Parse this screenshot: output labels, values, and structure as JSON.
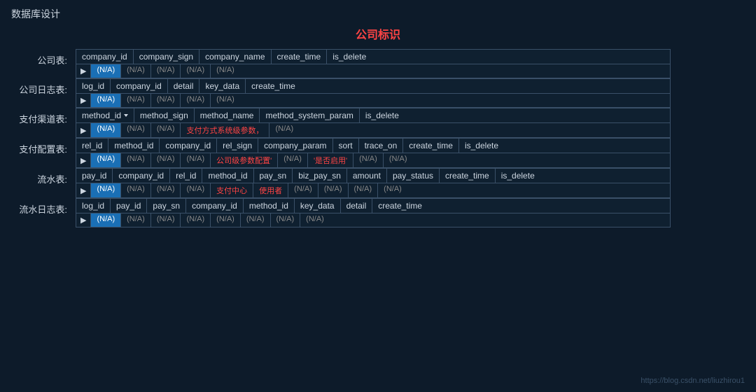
{
  "page": {
    "title": "数据库设计",
    "watermark": "https://blog.csdn.net/liuzhirou1",
    "center_label": "公司标识"
  },
  "tables": [
    {
      "label": "公司表:",
      "columns": [
        "company_id",
        "company_sign",
        "company_name",
        "create_time",
        "is_delete"
      ],
      "cells": [
        "(N/A)",
        "(N/A)",
        "(N/A)",
        "(N/A)",
        "(N/A)"
      ],
      "highlighted_col": 0,
      "special_cells": []
    },
    {
      "label": "公司日志表:",
      "columns": [
        "log_id",
        "company_id",
        "detail",
        "key_data",
        "create_time"
      ],
      "cells": [
        "(N/A)",
        "(N/A)",
        "(N/A)",
        "(N/A)",
        "(N/A)"
      ],
      "highlighted_col": 0,
      "special_cells": []
    },
    {
      "label": "支付渠道表:",
      "columns": [
        "method_id",
        "method_sign",
        "method_name",
        "method_system_param",
        "is_delete"
      ],
      "has_sort_on": 0,
      "cells": [
        "(N/A)",
        "(N/A)",
        "(N/A)",
        "支付方式系统级参数，",
        "(N/A)"
      ],
      "highlighted_col": 0,
      "special_cells": [
        3
      ]
    },
    {
      "label": "支付配置表:",
      "columns": [
        "rel_id",
        "method_id",
        "company_id",
        "rel_sign",
        "company_param",
        "sort",
        "trace_on",
        "create_time",
        "is_delete"
      ],
      "cells": [
        "(N/A)",
        "(N/A)",
        "(N/A)",
        "(N/A)",
        "公司级参数配置'",
        "(N/A)",
        "'是否启用'",
        "(N/A)",
        "(N/A)"
      ],
      "highlighted_col": 0,
      "special_cells": [
        4,
        6
      ]
    },
    {
      "label": "流水表:",
      "columns": [
        "pay_id",
        "company_id",
        "rel_id",
        "method_id",
        "pay_sn",
        "biz_pay_sn",
        "amount",
        "pay_status",
        "create_time",
        "is_delete"
      ],
      "cells": [
        "(N/A)",
        "(N/A)",
        "(N/A)",
        "(N/A)",
        "支付中心",
        "使用者",
        "(N/A)",
        "(N/A)",
        "(N/A)",
        "(N/A)"
      ],
      "highlighted_col": 0,
      "special_cells": [
        4,
        5
      ],
      "center_texts": [
        4,
        5
      ]
    },
    {
      "label": "流水日志表:",
      "columns": [
        "log_id",
        "pay_id",
        "pay_sn",
        "company_id",
        "method_id",
        "key_data",
        "detail",
        "create_time"
      ],
      "cells": [
        "(N/A)",
        "(N/A)",
        "(N/A)",
        "(N/A)",
        "(N/A)",
        "(N/A)",
        "(N/A)",
        "(N/A)"
      ],
      "highlighted_col": 0,
      "special_cells": []
    }
  ]
}
